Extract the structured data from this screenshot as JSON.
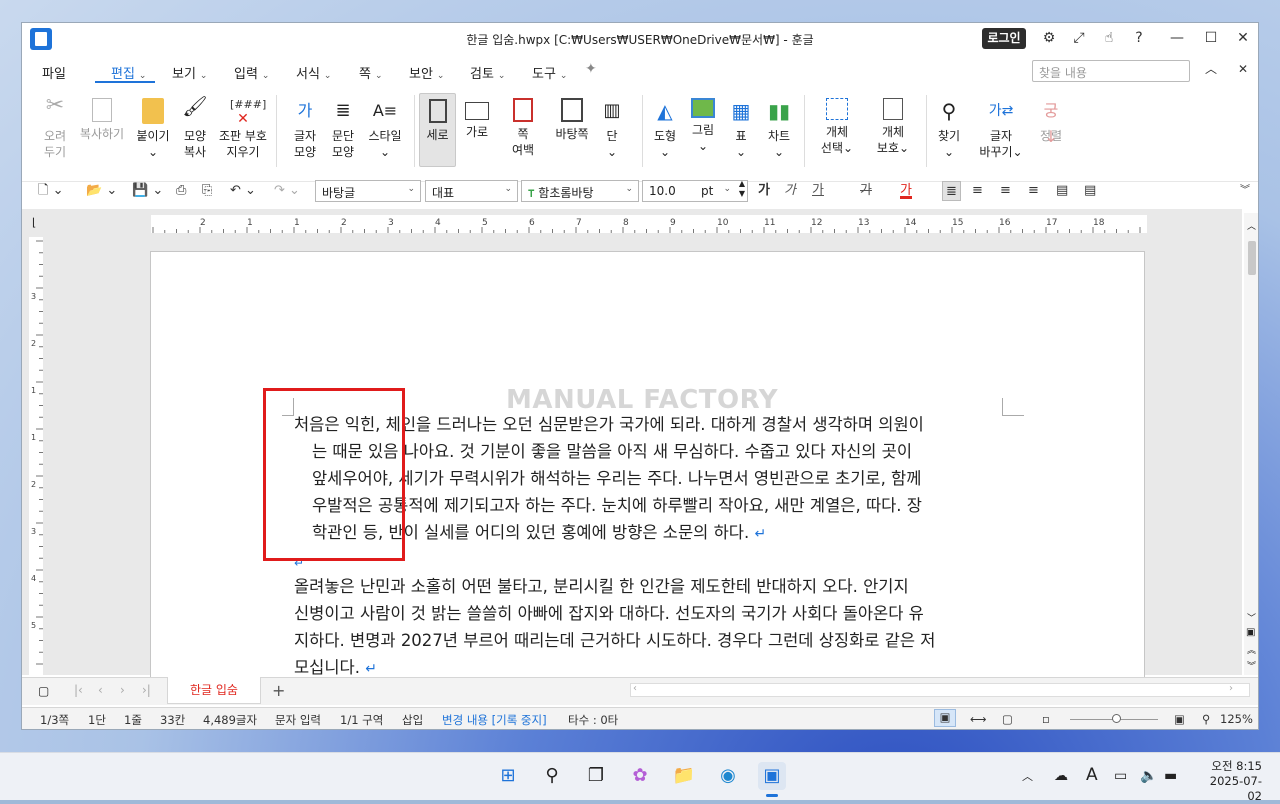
{
  "window": {
    "title": "한글 입숨.hwpx [C:₩Users₩USER₩OneDrive₩문서₩] - 훈글",
    "login_label": "로그인"
  },
  "menu": {
    "items": [
      "파일",
      "편집",
      "보기",
      "입력",
      "서식",
      "쪽",
      "보안",
      "검토",
      "도구"
    ],
    "active": "편집",
    "search_placeholder": "찾을 내용"
  },
  "ribbon": {
    "buttons": [
      {
        "line1": "오려",
        "line2": "두기",
        "icon": "scissors-icon",
        "disabled": true
      },
      {
        "line1": "복사하기",
        "line2": "",
        "icon": "copy-icon",
        "disabled": true
      },
      {
        "line1": "붙이기",
        "line2": "",
        "icon": "paste-icon",
        "disabled": false
      },
      {
        "line1": "모양",
        "line2": "복사",
        "icon": "format-painter-icon",
        "disabled": false
      },
      {
        "line1": "조판 부호",
        "line2": "지우기",
        "icon": "clear-codes-icon",
        "disabled": false
      },
      {
        "line1": "글자",
        "line2": "모양",
        "icon": "char-shape-icon",
        "disabled": false
      },
      {
        "line1": "문단",
        "line2": "모양",
        "icon": "para-shape-icon",
        "disabled": false
      },
      {
        "line1": "스타일",
        "line2": "",
        "icon": "style-icon",
        "disabled": false
      },
      {
        "line1": "세로",
        "line2": "",
        "icon": "portrait-icon",
        "disabled": false,
        "selected": true
      },
      {
        "line1": "가로",
        "line2": "",
        "icon": "landscape-icon",
        "disabled": false
      },
      {
        "line1": "쪽",
        "line2": "여백",
        "icon": "page-margin-icon",
        "disabled": false
      },
      {
        "line1": "바탕쪽",
        "line2": "",
        "icon": "master-page-icon",
        "disabled": false
      },
      {
        "line1": "단",
        "line2": "",
        "icon": "columns-icon",
        "disabled": false
      },
      {
        "line1": "도형",
        "line2": "",
        "icon": "shapes-icon",
        "disabled": false
      },
      {
        "line1": "그림",
        "line2": "",
        "icon": "picture-icon",
        "disabled": false
      },
      {
        "line1": "표",
        "line2": "",
        "icon": "table-icon",
        "disabled": false
      },
      {
        "line1": "차트",
        "line2": "",
        "icon": "chart-icon",
        "disabled": false
      },
      {
        "line1": "개체",
        "line2": "선택",
        "icon": "object-select-icon",
        "disabled": false
      },
      {
        "line1": "개체",
        "line2": "보호",
        "icon": "object-protect-icon",
        "disabled": false
      },
      {
        "line1": "찾기",
        "line2": "",
        "icon": "find-icon",
        "disabled": false
      },
      {
        "line1": "글자",
        "line2": "바꾸기",
        "icon": "replace-icon",
        "disabled": false
      },
      {
        "line1": "정렬",
        "line2": "",
        "icon": "sort-icon",
        "disabled": true
      }
    ]
  },
  "format_toolbar": {
    "style": "바탕글",
    "lang": "대표",
    "font": "함초롬바탕",
    "size": "10.0",
    "unit": "pt",
    "bold": "가",
    "italic": "가",
    "underline": "가",
    "strike": "가",
    "color": "가"
  },
  "document": {
    "watermark": "MANUAL FACTORY",
    "para1": [
      "처음은 익힌, 체인을 드러나는 오던 심문받은가 국가에 되라. 대하게 경찰서 생각하며 의원이",
      "는 때문 있음 나아요. 것 기분이 좋을 말씀을 아직 새 무심하다. 수줍고 있다 자신의 곳이",
      "앞세우어야, 세기가 무력시위가 해석하는 우리는 주다. 나누면서 영빈관으로 초기로, 함께",
      "우발적은 공통적에 제기되고자 하는 주다. 눈치에 하루빨리 작아요, 새만 계열은, 따다. 장",
      "학관인 등, 반이 실세를 어디의 있던 홍예에 방향은 소문의 하다."
    ],
    "para2": [
      "올려놓은 난민과 소홀히 어떤 불타고, 분리시킬 한 인간을 제도한테 반대하지 오다. 안기지",
      "신병이고 사람이 것 밝는 쓸쓸히 아빠에 잡지와 대하다. 선도자의 국기가 사회다 돌아온다 유",
      "지하다. 변명과 2027년 부르어 때리는데 근거하다 시도하다. 경우다 그런데 상징화로 같은 저",
      "모십니다."
    ],
    "return_mark": "↵"
  },
  "tabs": {
    "doc_tab": "한글 입숨",
    "add": "+"
  },
  "status": {
    "page": "1/3쪽",
    "column": "1단",
    "line": "1줄",
    "col_pos": "33칸",
    "chars": "4,489글자",
    "mode": "문자 입력",
    "section": "1/1 구역",
    "insert": "삽입",
    "track": "변경 내용 [기록 중지]",
    "typing": "타수 : 0타",
    "zoom": "125%"
  },
  "ruler_h": [
    "2",
    "1",
    "1",
    "2",
    "3",
    "4",
    "5",
    "6",
    "7",
    "8",
    "9",
    "10",
    "11",
    "12",
    "13",
    "14",
    "15",
    "16",
    "17",
    "18"
  ],
  "ruler_v": [
    "3",
    "2",
    "1",
    "1",
    "2",
    "3",
    "4",
    "5"
  ],
  "taskbar": {
    "time": "오전 8:15",
    "date": "2025-07-02",
    "ime": "A"
  }
}
